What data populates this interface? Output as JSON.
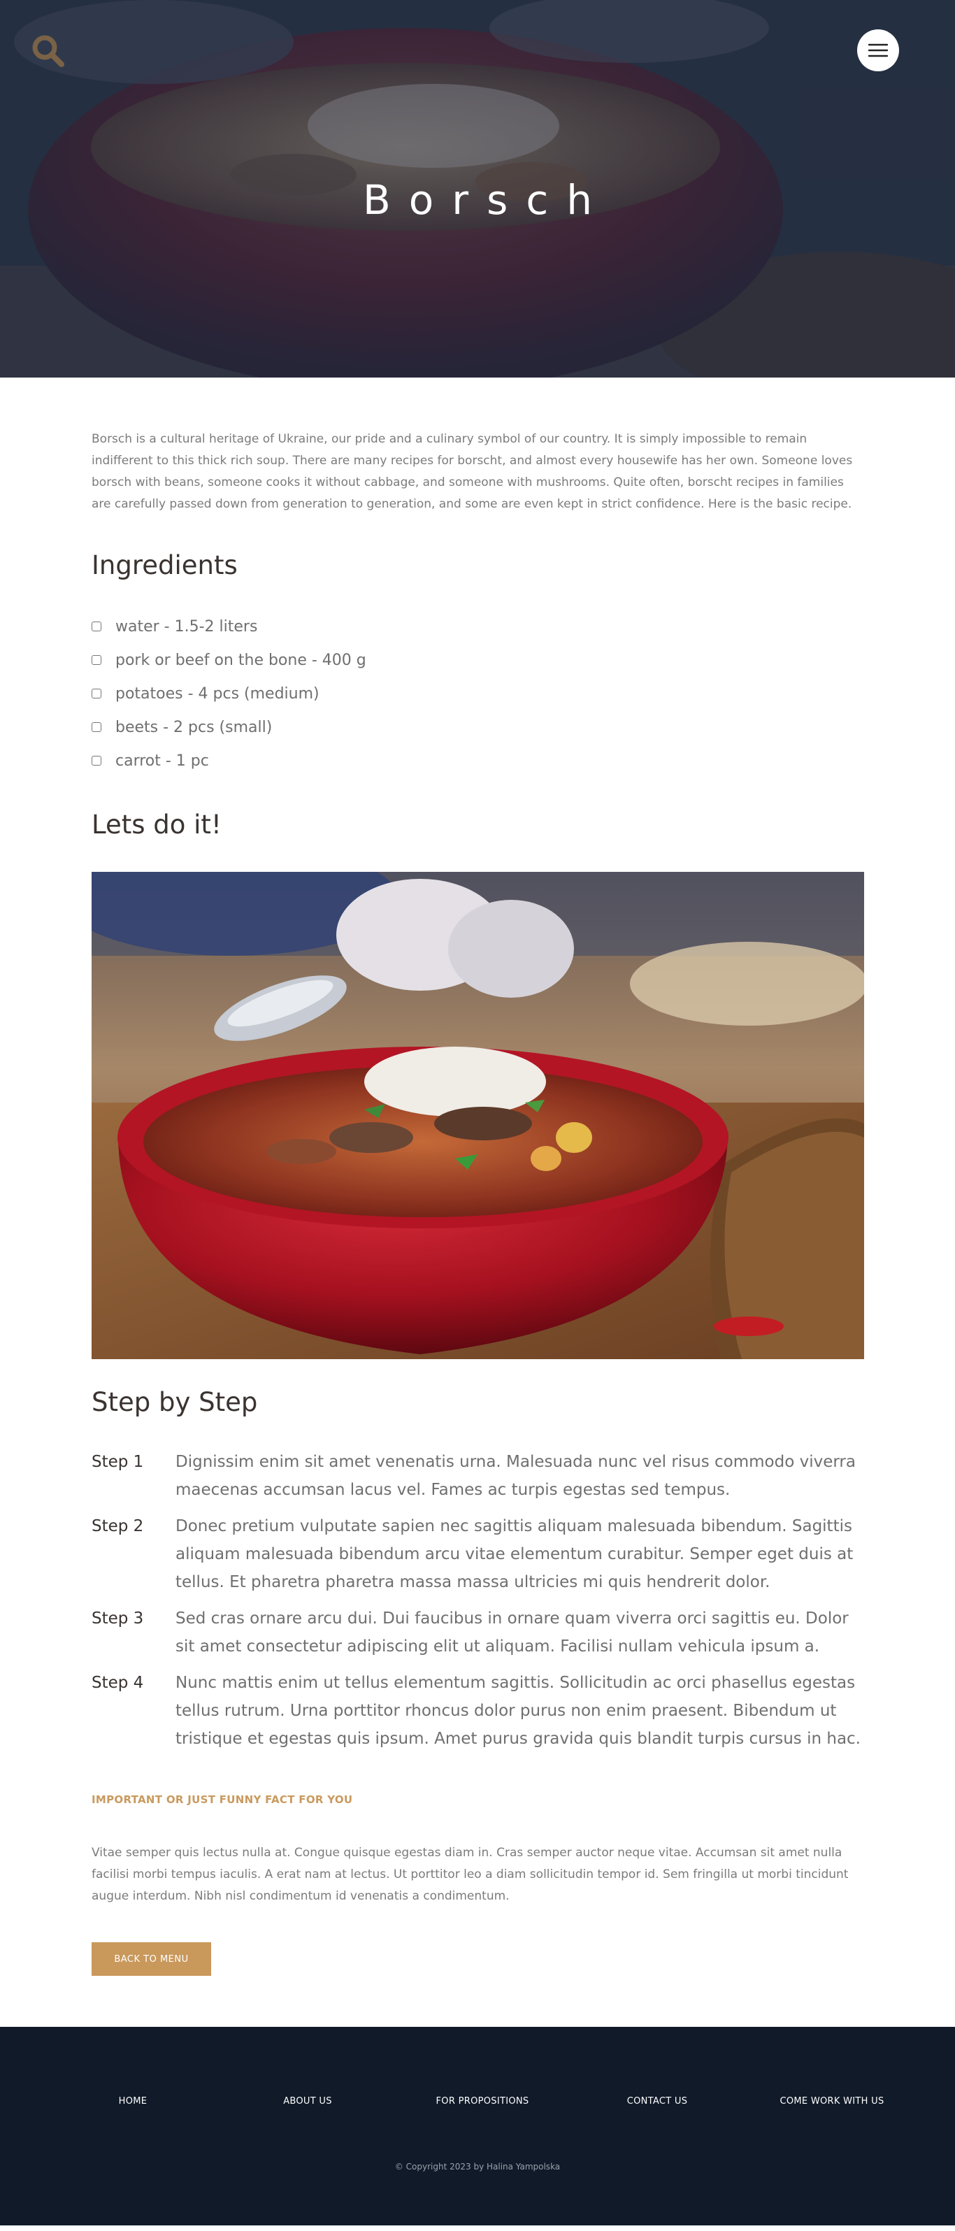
{
  "header": {
    "title": "Borsch",
    "search_icon": "search-icon",
    "menu_icon": "hamburger-menu-icon"
  },
  "intro": "Borsch is a cultural heritage of Ukraine, our pride and a culinary symbol of our country. It is simply impossible to remain indifferent to this thick rich soup. There are many recipes for borscht, and almost every housewife has her own. Someone loves borsch with beans, someone cooks it without cabbage, and someone with mushrooms. Quite often, borscht recipes in families are carefully passed down from generation to generation, and some are even kept in strict confidence. Here is the basic recipe.",
  "ingredients": {
    "title": "Ingredients",
    "items": [
      {
        "label": "water - 1.5-2 liters",
        "checked": false
      },
      {
        "label": "pork or beef on the bone - 400 g",
        "checked": false
      },
      {
        "label": "potatoes - 4 pcs (medium)",
        "checked": false
      },
      {
        "label": "beets - 2 pcs (small)",
        "checked": false
      },
      {
        "label": "carrot - 1 pc",
        "checked": false
      }
    ]
  },
  "doit_title": "Lets do it!",
  "steps": {
    "title": "Step by Step",
    "items": [
      {
        "label": "Step 1",
        "text": "Dignissim enim sit amet venenatis urna. Malesuada nunc vel risus commodo viverra maecenas accumsan lacus vel. Fames ac turpis egestas sed tempus."
      },
      {
        "label": "Step 2",
        "text": "Donec pretium vulputate sapien nec sagittis aliquam malesuada bibendum. Sagittis aliquam malesuada bibendum arcu vitae elementum curabitur. Semper eget duis at tellus. Et pharetra pharetra massa massa ultricies mi quis hendrerit dolor."
      },
      {
        "label": "Step 3",
        "text": "Sed cras ornare arcu dui. Dui faucibus in ornare quam viverra orci sagittis eu. Dolor sit amet consectetur adipiscing elit ut aliquam. Facilisi nullam vehicula ipsum a."
      },
      {
        "label": "Step 4",
        "text": "Nunc mattis enim ut tellus elementum sagittis. Sollicitudin ac orci phasellus egestas tellus rutrum. Urna porttitor rhoncus dolor purus non enim praesent. Bibendum ut tristique et egestas quis ipsum. Amet purus gravida quis blandit turpis cursus in hac."
      }
    ]
  },
  "fact": {
    "title": "Important or just funny fact for you",
    "text": "Vitae semper quis lectus nulla at. Congue quisque egestas diam in. Cras semper auctor neque vitae. Accumsan sit amet nulla facilisi morbi tempus iaculis. A erat nam at lectus. Ut porttitor leo a diam sollicitudin tempor id. Sem fringilla ut morbi tincidunt augue interdum. Nibh nisl condimentum id venenatis a condimentum."
  },
  "back_button": "Back to menu",
  "footer": {
    "links": [
      "Home",
      "About us",
      "For propositions",
      "Contact us",
      "Come work with us"
    ],
    "copyright": "© Copyright 2023 by Halina Yampolska"
  },
  "colors": {
    "accent": "#c9985b",
    "footer_bg": "#101a29",
    "heading": "#3a3330",
    "body_text": "#6f6f6f"
  }
}
